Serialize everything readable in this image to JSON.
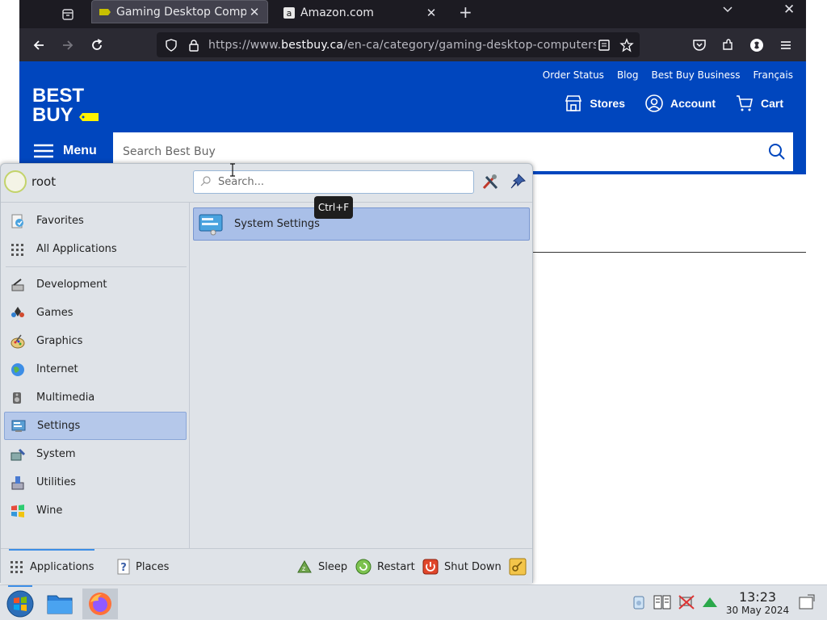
{
  "browser": {
    "tabs": [
      {
        "title": "Gaming Desktop Computers",
        "active": true
      },
      {
        "title": "Amazon.com",
        "active": false
      }
    ],
    "url": {
      "prefix": "https://www.",
      "domain": "bestbuy.ca",
      "path": "/en-ca/category/gaming-desktop-computers/"
    }
  },
  "site": {
    "logo_line1": "BEST",
    "logo_line2": "BUY",
    "top_links": [
      "Order Status",
      "Blog",
      "Best Buy Business",
      "Français"
    ],
    "actions": {
      "stores": "Stores",
      "account": "Account",
      "cart": "Cart"
    },
    "menu_label": "Menu",
    "search_placeholder": "Search Best Buy",
    "colors": {
      "header": "#0046be",
      "tag": "#fff200"
    }
  },
  "kmenu": {
    "user": "root",
    "search_placeholder": "Search...",
    "categories": [
      {
        "label": "Favorites",
        "icon": "favorites-icon"
      },
      {
        "label": "All Applications",
        "icon": "all-apps-icon"
      },
      {
        "label": "Development",
        "icon": "development-icon"
      },
      {
        "label": "Games",
        "icon": "games-icon"
      },
      {
        "label": "Graphics",
        "icon": "graphics-icon"
      },
      {
        "label": "Internet",
        "icon": "internet-icon"
      },
      {
        "label": "Multimedia",
        "icon": "multimedia-icon"
      },
      {
        "label": "Settings",
        "icon": "settings-icon",
        "selected": true
      },
      {
        "label": "System",
        "icon": "system-icon"
      },
      {
        "label": "Utilities",
        "icon": "utilities-icon"
      },
      {
        "label": "Wine",
        "icon": "wine-icon"
      }
    ],
    "apps": [
      {
        "label": "System Settings",
        "icon": "system-settings-icon"
      }
    ],
    "tooltip": "Ctrl+F",
    "bottom_tabs": {
      "applications": "Applications",
      "places": "Places"
    },
    "power": {
      "sleep": "Sleep",
      "restart": "Restart",
      "shutdown": "Shut Down"
    }
  },
  "taskbar": {
    "clock_time": "13:23",
    "clock_date": "30 May 2024"
  }
}
